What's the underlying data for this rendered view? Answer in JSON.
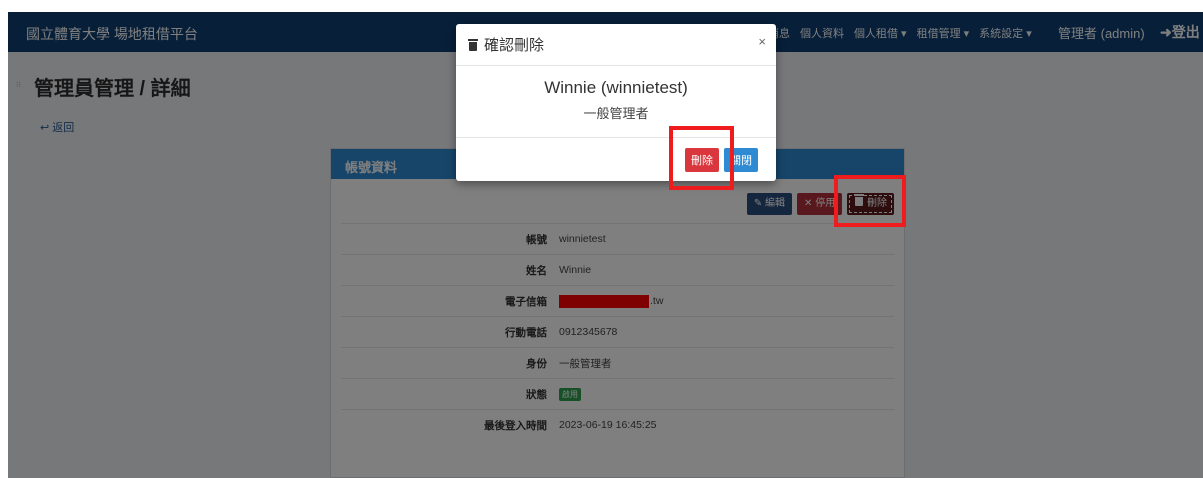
{
  "navbar": {
    "brand": "國立體育大學 場地租借平台",
    "menu": [
      "消息",
      "個人資料",
      "個人租借 ▾",
      "租借管理 ▾",
      "系統設定 ▾"
    ],
    "user": "管理者 (admin)",
    "logout": "登出",
    "logout_icon": "sign-out-icon"
  },
  "page": {
    "title": "管理員管理 / 詳細",
    "back_label": "返回"
  },
  "panel": {
    "title": "帳號資料",
    "buttons": {
      "edit": "編輯",
      "disable": "停用",
      "delete": "刪除"
    },
    "rows": [
      {
        "label": "帳號",
        "value": "winnietest"
      },
      {
        "label": "姓名",
        "value": "Winnie"
      },
      {
        "label": "電子信箱",
        "value": ".tw"
      },
      {
        "label": "行動電話",
        "value": "0912345678"
      },
      {
        "label": "身份",
        "value": "一般管理者"
      },
      {
        "label": "狀態",
        "value": "啟用"
      },
      {
        "label": "最後登入時間",
        "value": "2023-06-19 16:45:25"
      }
    ]
  },
  "modal": {
    "title": "確認刪除",
    "close": "×",
    "name": "Winnie (winnietest)",
    "role": "一般管理者",
    "delete_button": "刪除",
    "close_button": "關閉"
  },
  "colors": {
    "navbar": "#0e3e73",
    "panel_header": "#2e8ad2",
    "danger": "#d9363e",
    "highlight": "#ee1c1c"
  }
}
